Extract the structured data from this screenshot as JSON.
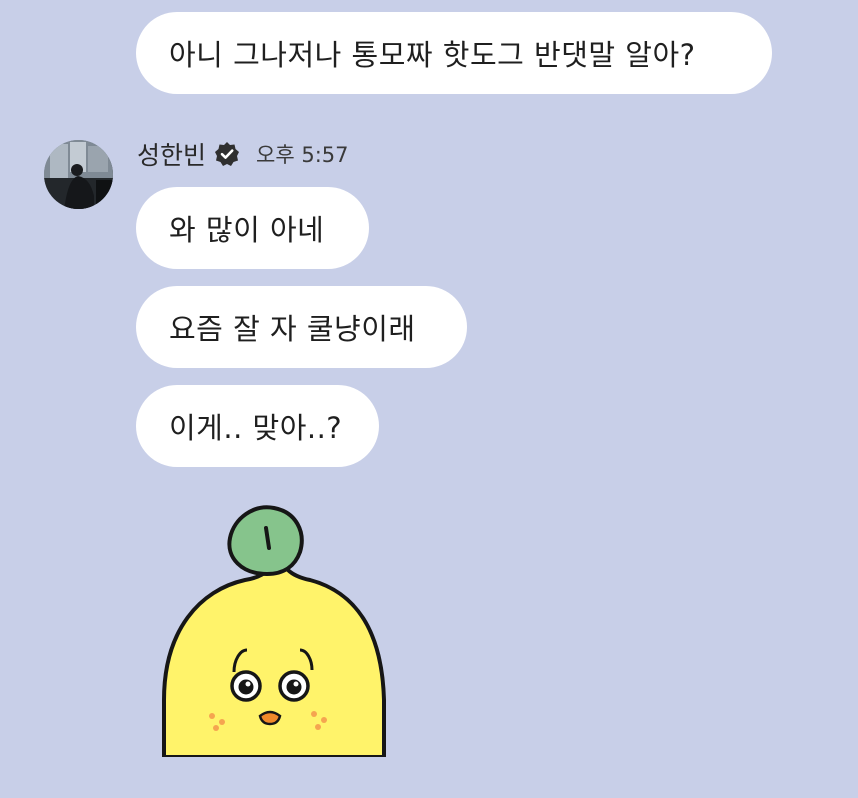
{
  "messages": {
    "previous_outgoing": "아니 그나저나 통모짜 핫도그 반댓말 알아?"
  },
  "sender": {
    "name": "성한빈",
    "time": "오후 5:57",
    "verified_icon": "verified-badge-icon"
  },
  "incoming": [
    "와 많이 아네",
    "요즘 잘 자 쿨냥이래",
    "이게.. 맞아..?"
  ],
  "sticker": {
    "description_icon": "lemon-character-sticker",
    "leaf_color": "#86c48c",
    "body_color": "#fff36a"
  },
  "colors": {
    "background": "#c8cfe8",
    "bubble": "#ffffff"
  }
}
